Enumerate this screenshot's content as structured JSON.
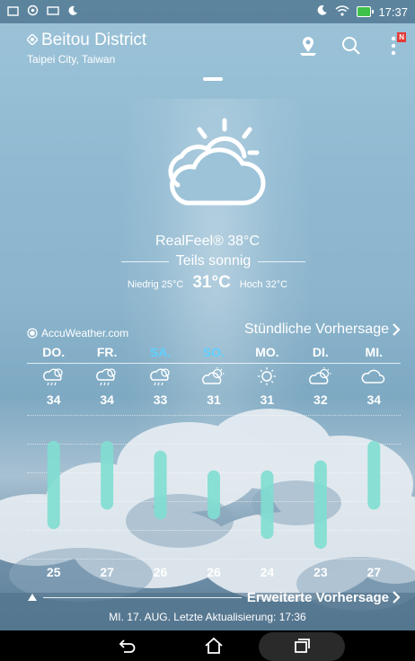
{
  "statusbar": {
    "time": "17:37",
    "battery_color": "#3fc24a"
  },
  "header": {
    "location": "Beitou District",
    "sublocation": "Taipei City, Taiwan",
    "notification_badge": "N"
  },
  "current": {
    "realfeel": "RealFeel® 38°C",
    "condition": "Teils sonnig",
    "low": "Niedrig 25°C",
    "now": "31°C",
    "high": "Hoch 32°C"
  },
  "forecast": {
    "provider": "AccuWeather.com",
    "hourly_link": "Stündliche Vorhersage",
    "days": [
      {
        "name": "DO.",
        "icon": "rain-sun-icon",
        "high": "34",
        "low": "25",
        "weekend": false
      },
      {
        "name": "FR.",
        "icon": "rain-sun-icon",
        "high": "34",
        "low": "27",
        "weekend": false
      },
      {
        "name": "SA.",
        "icon": "rain-sun-icon",
        "high": "33",
        "low": "26",
        "weekend": true
      },
      {
        "name": "SO.",
        "icon": "partly-sunny-icon",
        "high": "31",
        "low": "26",
        "weekend": true
      },
      {
        "name": "MO.",
        "icon": "sunny-icon",
        "high": "31",
        "low": "24",
        "weekend": false
      },
      {
        "name": "DI.",
        "icon": "partly-sunny-icon",
        "high": "32",
        "low": "23",
        "weekend": false
      },
      {
        "name": "MI.",
        "icon": "cloudy-icon",
        "high": "34",
        "low": "27",
        "weekend": false
      }
    ],
    "bar_color": "#7fded0",
    "weekend_color": "#5fd0ff",
    "extended_link": "Erweiterte Vorhersage",
    "updated": "MI. 17. AUG. Letzte Aktualisierung: 17:36"
  }
}
